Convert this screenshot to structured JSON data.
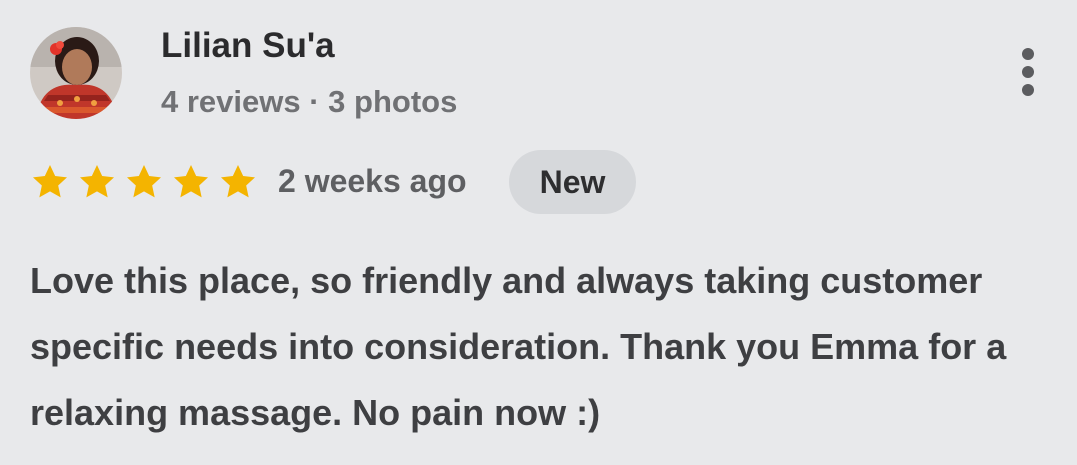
{
  "review": {
    "author_name": "Lilian Su'a",
    "author_meta": "4 reviews · 3 photos",
    "rating": 5,
    "rating_max": 5,
    "time_ago": "2 weeks ago",
    "badge": "New",
    "text": "Love this place, so friendly and always taking customer specific needs into consideration. Thank you Emma for a relaxing massage. No pain now :)"
  },
  "icons": {
    "more": "more-vert-icon",
    "star": "star-icon"
  },
  "colors": {
    "star": "#f4b400",
    "background": "#e8e9eb",
    "badge_bg": "#d6d8db"
  }
}
